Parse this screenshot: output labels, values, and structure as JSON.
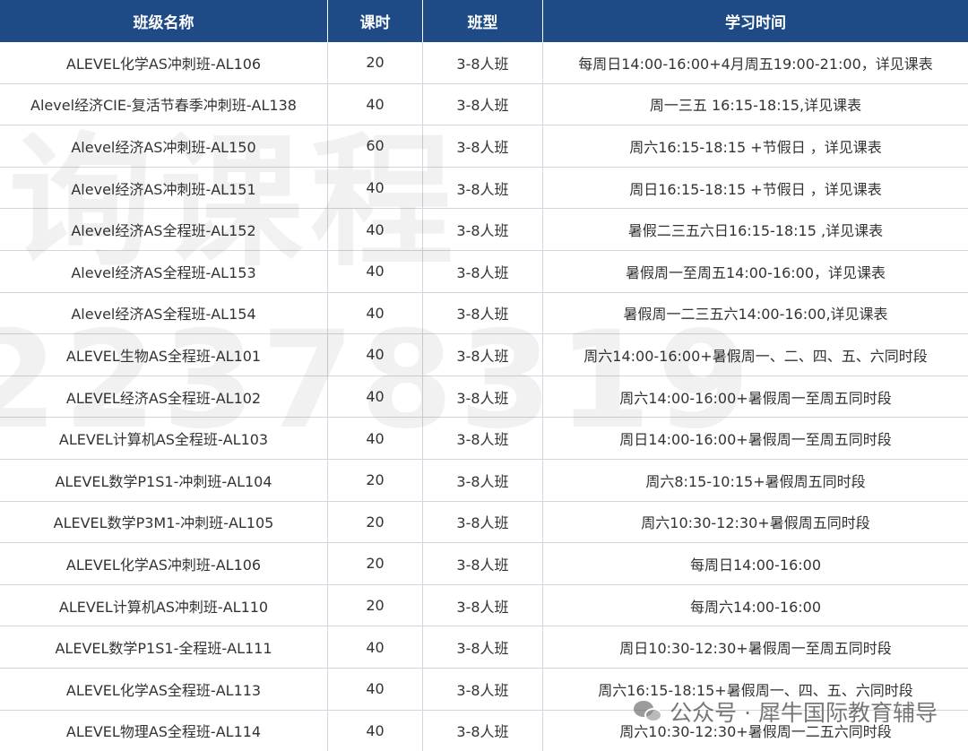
{
  "watermark": {
    "text_1": "询课程",
    "text_2": "22378319"
  },
  "table": {
    "headers": [
      "班级名称",
      "课时",
      "班型",
      "学习时间"
    ],
    "rows": [
      [
        "ALEVEL化学AS冲刺班-AL106",
        "20",
        "3-8人班",
        "每周日14:00-16:00+4月周五19:00-21:00，详见课表"
      ],
      [
        "Alevel经济CIE-复活节春季冲刺班-AL138",
        "40",
        "3-8人班",
        "周一三五 16:15-18:15,详见课表"
      ],
      [
        "Alevel经济AS冲刺班-AL150",
        "60",
        "3-8人班",
        "周六16:15-18:15 +节假日 ，详见课表"
      ],
      [
        "Alevel经济AS冲刺班-AL151",
        "40",
        "3-8人班",
        "周日16:15-18:15 +节假日 ，详见课表"
      ],
      [
        "Alevel经济AS全程班-AL152",
        "40",
        "3-8人班",
        "暑假二三五六日16:15-18:15 ,详见课表"
      ],
      [
        "Alevel经济AS全程班-AL153",
        "40",
        "3-8人班",
        "暑假周一至周五14:00-16:00，详见课表"
      ],
      [
        "Alevel经济AS全程班-AL154",
        "40",
        "3-8人班",
        "暑假周一二三五六14:00-16:00,详见课表"
      ],
      [
        "ALEVEL生物AS全程班-AL101",
        "40",
        "3-8人班",
        "周六14:00-16:00+暑假周一、二、四、五、六同时段"
      ],
      [
        "ALEVEL经济AS全程班-AL102",
        "40",
        "3-8人班",
        "周六14:00-16:00+暑假周一至周五同时段"
      ],
      [
        "ALEVEL计算机AS全程班-AL103",
        "40",
        "3-8人班",
        "周日14:00-16:00+暑假周一至周五同时段"
      ],
      [
        "ALEVEL数学P1S1-冲刺班-AL104",
        "20",
        "3-8人班",
        "周六8:15-10:15+暑假周五同时段"
      ],
      [
        "ALEVEL数学P3M1-冲刺班-AL105",
        "20",
        "3-8人班",
        "周六10:30-12:30+暑假周五同时段"
      ],
      [
        "ALEVEL化学AS冲刺班-AL106",
        "20",
        "3-8人班",
        "每周日14:00-16:00"
      ],
      [
        "ALEVEL计算机AS冲刺班-AL110",
        "20",
        "3-8人班",
        "每周六14:00-16:00"
      ],
      [
        "ALEVEL数学P1S1-全程班-AL111",
        "40",
        "3-8人班",
        "周日10:30-12:30+暑假周一至周五同时段"
      ],
      [
        "ALEVEL化学AS全程班-AL113",
        "40",
        "3-8人班",
        "周六16:15-18:15+暑假周一、四、五、六同时段"
      ],
      [
        "ALEVEL物理AS全程班-AL114",
        "40",
        "3-8人班",
        "周六10:30-12:30+暑假周一二五六同时段"
      ]
    ]
  },
  "footer": {
    "icon": "wechat-icon",
    "text": "公众号 · 犀牛国际教育辅导"
  }
}
